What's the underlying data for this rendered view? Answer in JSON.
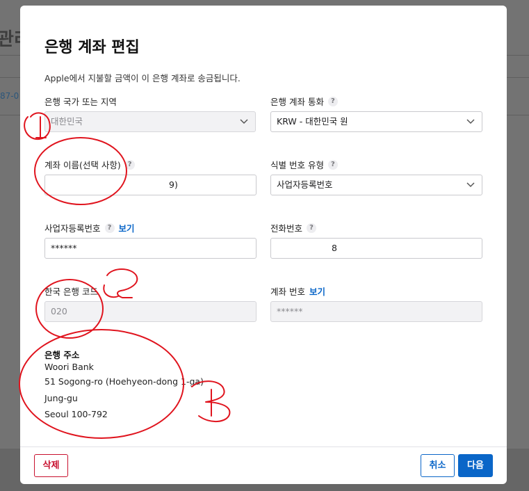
{
  "background": {
    "title_fragment": "관리",
    "link_fragment": "87-0"
  },
  "dialog": {
    "title": "은행 계좌 편집",
    "description": "Apple에서 지불할 금액이 이 은행 계좌로 송금됩니다.",
    "help_glyph": "?",
    "fields": {
      "country": {
        "label": "은행 국가 또는 지역",
        "value": "대한민국"
      },
      "currency": {
        "label": "은행 계좌 통화",
        "value": "KRW - 대한민국 원"
      },
      "account_name": {
        "label": "계좌 이름(선택 사항)",
        "value": "9)"
      },
      "id_type": {
        "label": "식별 번호 유형",
        "value": "사업자등록번호"
      },
      "business_number": {
        "label": "사업자등록번호",
        "link": "보기",
        "value": "******"
      },
      "phone": {
        "label": "전화번호",
        "value": "8"
      },
      "bank_code": {
        "label": "한국 은행 코드",
        "value": "020"
      },
      "account_number": {
        "label": "계좌 번호",
        "link": "보기",
        "value": "******"
      }
    },
    "bank_address": {
      "title": "은행 주소",
      "lines": [
        "Woori Bank",
        "51 Sogong-ro (Hoehyeon-dong 1-ga)",
        "Jung-gu",
        "Seoul 100-792"
      ]
    },
    "buttons": {
      "delete": "삭제",
      "cancel": "취소",
      "next": "다음"
    }
  },
  "annotations": {
    "color": "#e0141e",
    "marks": [
      "1",
      "2",
      "3"
    ]
  }
}
